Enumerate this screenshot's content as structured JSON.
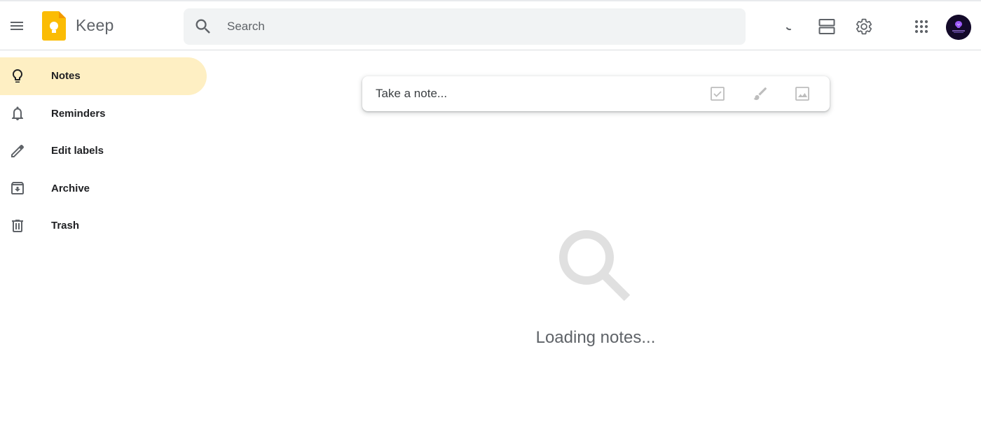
{
  "app": {
    "name": "Keep",
    "brand_color": "#fbbc04"
  },
  "header": {
    "search": {
      "placeholder": "Search",
      "value": ""
    },
    "icons": [
      "main-menu-icon",
      "keep-logo-icon",
      "search-icon",
      "refresh-icon",
      "list-view-icon",
      "settings-icon",
      "apps-grid-icon",
      "account-avatar"
    ]
  },
  "sidebar": {
    "active_color": "#feefc3",
    "items": [
      {
        "label": "Notes",
        "icon": "lightbulb-icon",
        "active": true
      },
      {
        "label": "Reminders",
        "icon": "bell-icon",
        "active": false
      },
      {
        "label": "Edit labels",
        "icon": "pencil-icon",
        "active": false
      },
      {
        "label": "Archive",
        "icon": "archive-icon",
        "active": false
      },
      {
        "label": "Trash",
        "icon": "trash-icon",
        "active": false
      }
    ]
  },
  "take_note": {
    "placeholder": "Take a note...",
    "tools": [
      "new-list-icon",
      "new-drawing-icon",
      "new-image-icon"
    ]
  },
  "main": {
    "status_text": "Loading notes..."
  }
}
